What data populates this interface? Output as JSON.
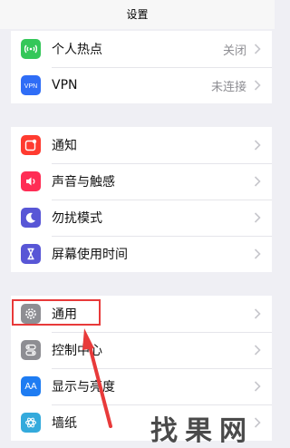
{
  "nav": {
    "title": "设置"
  },
  "sections": [
    {
      "items": [
        {
          "label": "个人热点",
          "value": "关闭",
          "icon": "hotspot-icon",
          "color": "#34c759"
        },
        {
          "label": "VPN",
          "value": "未连接",
          "icon": "vpn-icon",
          "color": "#2f6df6"
        }
      ]
    },
    {
      "items": [
        {
          "label": "通知",
          "icon": "notifications-icon",
          "color": "#ff3b30"
        },
        {
          "label": "声音与触感",
          "icon": "sound-icon",
          "color": "#ff2d55"
        },
        {
          "label": "勿扰模式",
          "icon": "moon-icon",
          "color": "#5856d6"
        },
        {
          "label": "屏幕使用时间",
          "icon": "hourglass-icon",
          "color": "#5856d6"
        }
      ]
    },
    {
      "items": [
        {
          "label": "通用",
          "icon": "gear-icon",
          "color": "#8e8e93"
        },
        {
          "label": "控制中心",
          "icon": "toggles-icon",
          "color": "#8e8e93"
        },
        {
          "label": "显示与亮度",
          "icon": "aa-icon",
          "color": "#1e7cf2",
          "icon_text": "AA"
        },
        {
          "label": "墙纸",
          "icon": "wallpaper-icon",
          "color": "#34aadc"
        }
      ]
    }
  ],
  "annotation": {
    "color": "#e83a3a"
  },
  "watermark": {
    "text": "找果网"
  }
}
